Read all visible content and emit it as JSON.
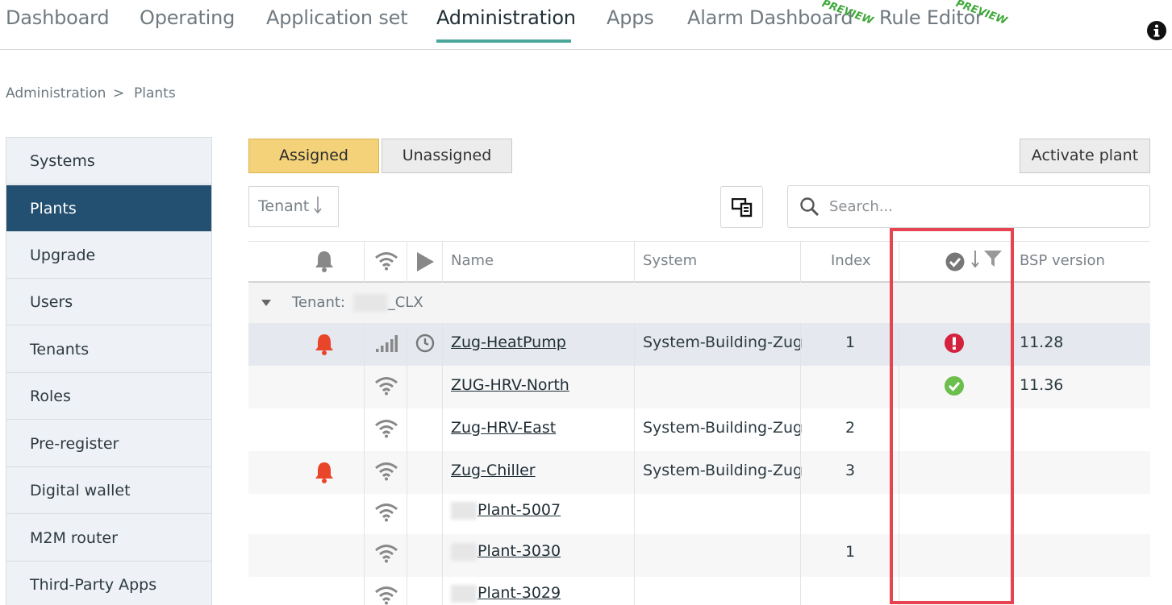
{
  "nav": {
    "items": [
      "Dashboard",
      "Operating",
      "Application set",
      "Administration",
      "Apps",
      "Alarm Dashboard",
      "Rule Editor"
    ],
    "preview_label": "PREVIEW"
  },
  "breadcrumb": {
    "root": "Administration",
    "separator": ">",
    "current": "Plants"
  },
  "sidebar": {
    "items": [
      "Systems",
      "Plants",
      "Upgrade",
      "Users",
      "Tenants",
      "Roles",
      "Pre-register",
      "Digital wallet",
      "M2M router",
      "Third-Party Apps"
    ]
  },
  "toolbar": {
    "assigned_label": "Assigned",
    "unassigned_label": "Unassigned",
    "activate_label": "Activate plant",
    "tenant_sort_label": "Tenant",
    "search_placeholder": "Search..."
  },
  "table": {
    "headers": {
      "name": "Name",
      "system": "System",
      "index": "Index",
      "bsp": "BSP version"
    },
    "group": {
      "label": "Tenant:",
      "value": "_CLX"
    },
    "rows": [
      {
        "name": "Zug-HeatPump",
        "system": "System-Building-Zug",
        "index": "1",
        "bsp": "11.28"
      },
      {
        "name": "ZUG-HRV-North",
        "system": "",
        "index": "",
        "bsp": "11.36"
      },
      {
        "name": "Zug-HRV-East",
        "system": "System-Building-Zug",
        "index": "2",
        "bsp": ""
      },
      {
        "name": "Zug-Chiller",
        "system": "System-Building-Zug",
        "index": "3",
        "bsp": ""
      },
      {
        "name": "Plant-5007",
        "system": "",
        "index": "",
        "bsp": ""
      },
      {
        "name": "Plant-3030",
        "system": "",
        "index": "1",
        "bsp": ""
      },
      {
        "name": "Plant-3029",
        "system": "",
        "index": "",
        "bsp": ""
      }
    ]
  },
  "colors": {
    "accent": "#4aa89b",
    "sidebar_active": "#234f70",
    "assigned_button": "#f3d27a",
    "alarm": "#e8452a",
    "ok": "#6cbf4c",
    "error": "#d4213d",
    "highlight": "#e64451"
  }
}
